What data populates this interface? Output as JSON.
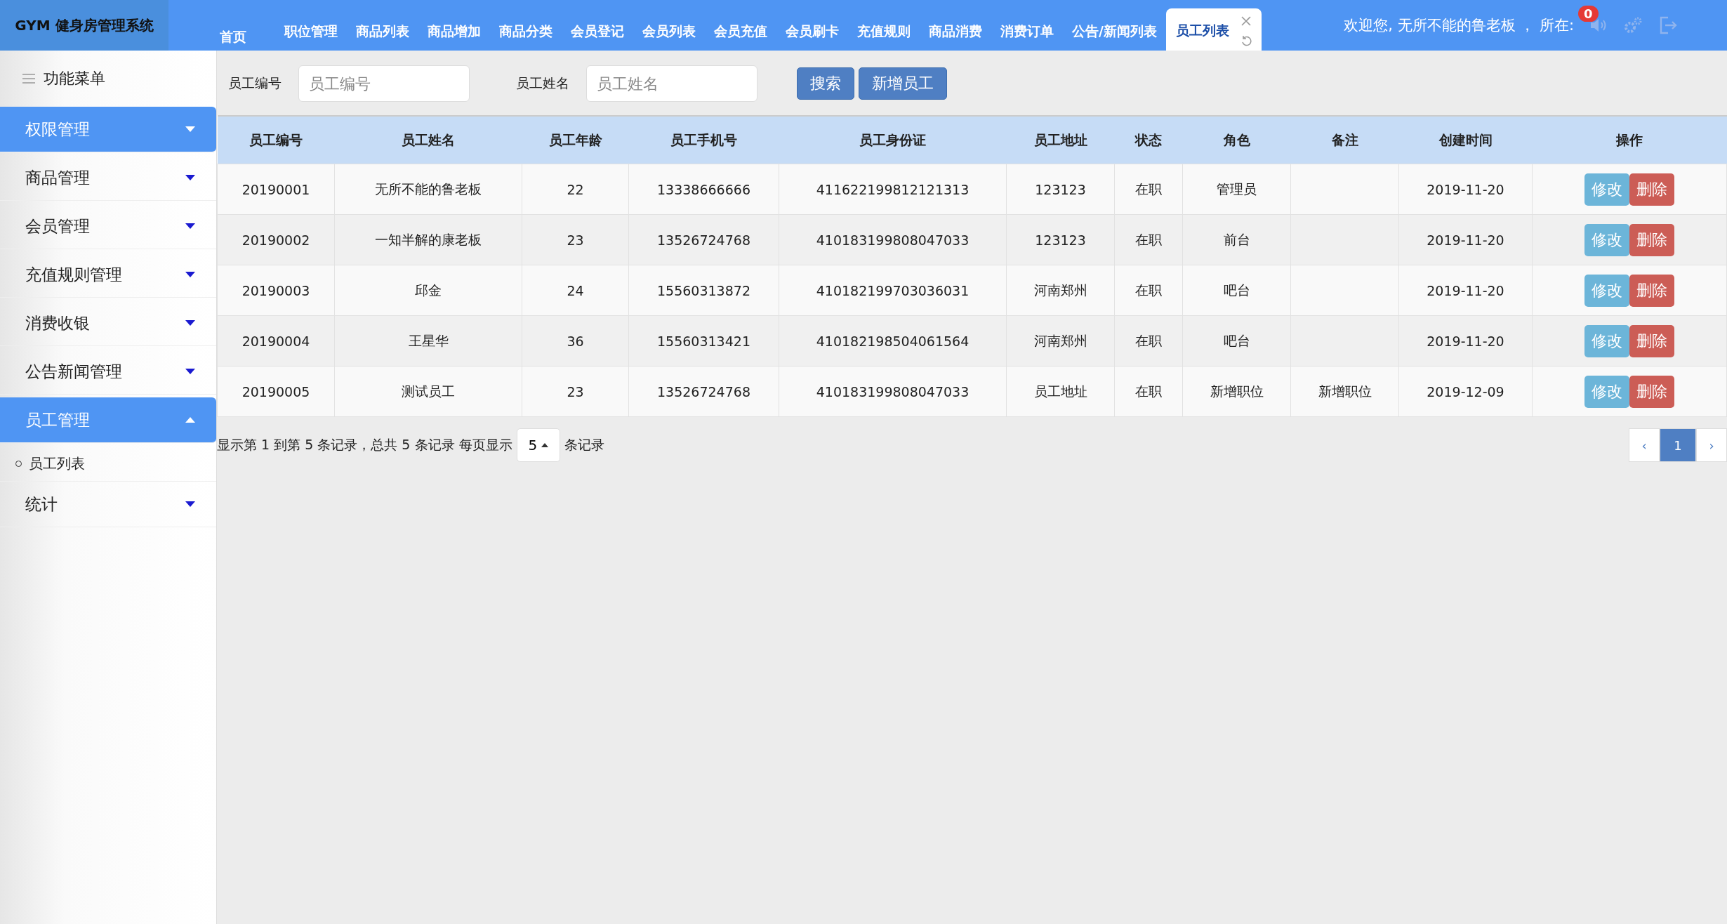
{
  "logo": "GYM 健身房管理系统",
  "tabs": [
    {
      "label": "首页",
      "selected": false
    },
    {
      "label": "职位管理",
      "selected": false
    },
    {
      "label": "商品列表",
      "selected": false
    },
    {
      "label": "商品增加",
      "selected": false
    },
    {
      "label": "商品分类",
      "selected": false
    },
    {
      "label": "会员登记",
      "selected": false
    },
    {
      "label": "会员列表",
      "selected": false
    },
    {
      "label": "会员充值",
      "selected": false
    },
    {
      "label": "会员刷卡",
      "selected": false
    },
    {
      "label": "充值规则",
      "selected": false
    },
    {
      "label": "商品消费",
      "selected": false
    },
    {
      "label": "消费订单",
      "selected": false
    },
    {
      "label": "公告/新闻列表",
      "selected": false
    },
    {
      "label": "员工列表",
      "selected": true
    }
  ],
  "header": {
    "welcome": "欢迎您, 无所不能的鲁老板 ， 所在:",
    "badge": "0"
  },
  "sidebar": {
    "title": "功能菜单",
    "items": [
      {
        "label": "权限管理",
        "selected": true,
        "expanded": false
      },
      {
        "label": "商品管理",
        "selected": false,
        "expanded": false
      },
      {
        "label": "会员管理",
        "selected": false,
        "expanded": false
      },
      {
        "label": "充值规则管理",
        "selected": false,
        "expanded": false
      },
      {
        "label": "消费收银",
        "selected": false,
        "expanded": false
      },
      {
        "label": "公告新闻管理",
        "selected": false,
        "expanded": false
      },
      {
        "label": "员工管理",
        "selected": true,
        "expanded": true,
        "children": [
          {
            "label": "员工列表"
          }
        ]
      },
      {
        "label": "统计",
        "selected": false,
        "expanded": false
      }
    ]
  },
  "search": {
    "fields": [
      {
        "label": "员工编号",
        "placeholder": "员工编号"
      },
      {
        "label": "员工姓名",
        "placeholder": "员工姓名"
      }
    ],
    "buttons": [
      "搜索",
      "新增员工"
    ]
  },
  "table": {
    "columns": [
      "员工编号",
      "员工姓名",
      "员工年龄",
      "员工手机号",
      "员工身份证",
      "员工地址",
      "状态",
      "角色",
      "备注",
      "创建时间",
      "操作"
    ],
    "rows": [
      {
        "cells": [
          "20190001",
          "无所不能的鲁老板",
          "22",
          "13338666666",
          "411622199812121313",
          "123123",
          "在职",
          "管理员",
          "",
          "2019-11-20"
        ],
        "actions": [
          "修改",
          "删除"
        ]
      },
      {
        "cells": [
          "20190002",
          "一知半解的康老板",
          "23",
          "13526724768",
          "410183199808047033",
          "123123",
          "在职",
          "前台",
          "",
          "2019-11-20"
        ],
        "actions": [
          "修改",
          "删除"
        ]
      },
      {
        "cells": [
          "20190003",
          "邱金",
          "24",
          "15560313872",
          "410182199703036031",
          "河南郑州",
          "在职",
          "吧台",
          "",
          "2019-11-20"
        ],
        "actions": [
          "修改",
          "删除"
        ]
      },
      {
        "cells": [
          "20190004",
          "王星华",
          "36",
          "15560313421",
          "410182198504061564",
          "河南郑州",
          "在职",
          "吧台",
          "",
          "2019-11-20"
        ],
        "actions": [
          "修改",
          "删除"
        ]
      },
      {
        "cells": [
          "20190005",
          "测试员工",
          "23",
          "13526724768",
          "410183199808047033",
          "员工地址",
          "在职",
          "新增职位",
          "新增职位",
          "2019-12-09"
        ],
        "actions": [
          "修改",
          "删除"
        ]
      }
    ]
  },
  "pagination": {
    "summary": "显示第 1 到第 5 条记录，总共 5 条记录 每页显示",
    "page_size": "5",
    "suffix": "条记录",
    "prev": "‹",
    "pages": [
      {
        "label": "1",
        "selected": true
      }
    ],
    "next": "›"
  }
}
